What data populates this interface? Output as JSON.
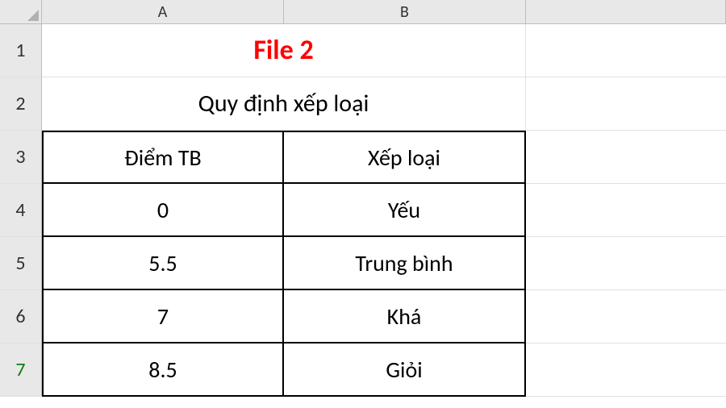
{
  "columns": [
    "A",
    "B"
  ],
  "rows": [
    "1",
    "2",
    "3",
    "4",
    "5",
    "6",
    "7"
  ],
  "activeRow": "7",
  "title": "File 2",
  "subtitle": "Quy định xếp loại",
  "headers": {
    "colA": "Điểm TB",
    "colB": "Xếp loại"
  },
  "data": [
    {
      "a": "0",
      "b": "Yếu"
    },
    {
      "a": "5.5",
      "b": "Trung bình"
    },
    {
      "a": "7",
      "b": "Khá"
    },
    {
      "a": "8.5",
      "b": "Giỏi"
    }
  ],
  "chart_data": {
    "type": "table",
    "title": "Quy định xếp loại",
    "columns": [
      "Điểm TB",
      "Xếp loại"
    ],
    "rows": [
      [
        0,
        "Yếu"
      ],
      [
        5.5,
        "Trung bình"
      ],
      [
        7,
        "Khá"
      ],
      [
        8.5,
        "Giỏi"
      ]
    ]
  }
}
